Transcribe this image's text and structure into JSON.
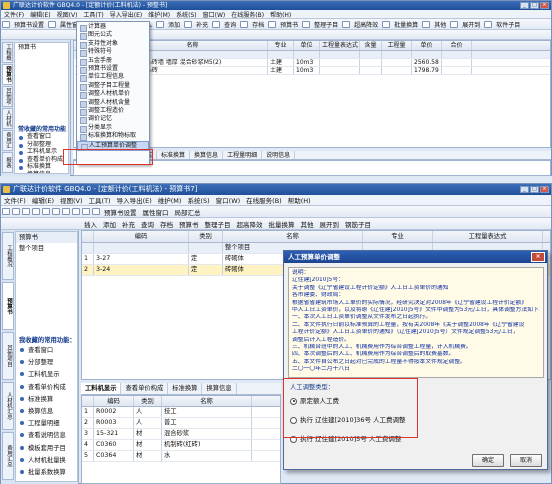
{
  "top": {
    "title": "广联达计价软件 GBQ4.0 - [定额计价(工料机法) - 预整书]",
    "menu": [
      "文件(F)",
      "编辑(E)",
      "视图(V)",
      "工具(T)",
      "导入导出(E)",
      "维护(M)",
      "系统(S)",
      "窗口(W)",
      "在线服务(B)",
      "帮助(H)"
    ],
    "toolbar": [
      "预算书设置",
      "属性窗口",
      "局部汇总",
      "插入",
      "添加",
      "补充",
      "查询",
      "存档",
      "预算书",
      "整理子目",
      "超高降效",
      "批量换算",
      "其他",
      "展开到",
      "软件子目"
    ],
    "side_tabs": [
      "工程概况",
      "预算书",
      "其他项目",
      "人材机汇总",
      "费用汇总",
      "报表"
    ],
    "nav_header": "常收藏的常用功能",
    "nav_items": [
      "查看窗口",
      "分部整理",
      "工料机显示",
      "查看单价构成",
      "标准换算",
      "换算信息",
      "工程量明细",
      "查看说明信息",
      "模板套价子目",
      "人材机批量换",
      "批量系数换算"
    ],
    "grid_headers": [
      "编码",
      "类别",
      "名称",
      "专业",
      "单位",
      "工程量表达式",
      "含量",
      "工程量",
      "单价",
      "合价"
    ],
    "grid_rows": [
      {
        "code": "",
        "cat": "",
        "name": "整个项目",
        "spec": "",
        "unit": "",
        "expr": "",
        "qty": "",
        "amt": "",
        "price": "",
        "total": ""
      },
      {
        "code": "3-27",
        "cat": "定",
        "name": "砖砌体 实心砖墙 墙厚 混合砂浆M5(2)",
        "spec": "土建",
        "unit": "10m3",
        "expr": "",
        "qty": "",
        "amt": "",
        "price": "2560.58",
        "total": ""
      },
      {
        "code": "3-24",
        "cat": "定",
        "name": "砖砌体 空心砖",
        "spec": "土建",
        "unit": "10m3",
        "expr": "",
        "qty": "",
        "amt": "",
        "price": "1798.79",
        "total": ""
      }
    ],
    "context_menu": [
      "计算器",
      "图元公式",
      "支持性对象",
      "特殊符号",
      "五金手册",
      "预算书设置",
      "单位工程信息",
      "调整子目工程量",
      "调整人材机单价",
      "调整人材机含量",
      "调整工程造价",
      "调价记忆",
      "分类显示",
      "标准换算和物标取",
      "人工预算单价调整"
    ],
    "bottom_tabs": [
      "工料机显示",
      "查看单价构成",
      "标准换算",
      "换算信息",
      "工程量明细",
      "说明信息"
    ]
  },
  "main": {
    "title": "广联达计价软件 GBQ4.0 - [定额计价(工料机法) - 预算书7]",
    "menu": [
      "文件(F)",
      "编辑(E)",
      "视图(V)",
      "工具(T)",
      "导入导出(E)",
      "维护(M)",
      "系统(S)",
      "窗口(W)",
      "在线服务(B)",
      "帮助(H)"
    ],
    "toolbar": [
      "预算书设置",
      "属性窗口",
      "局部汇总"
    ],
    "toolbar2": [
      "插入",
      "添加",
      "补充",
      "查询",
      "存档",
      "预算书",
      "整理子目",
      "超高降效",
      "批量换算",
      "其他",
      "展开到",
      "钢筋子目"
    ],
    "side_tabs": [
      "工程概况",
      "预算书",
      "其他项目",
      "人材机汇总",
      "费用汇总"
    ],
    "nav_header": "我收藏的常用功能：",
    "nav_items": [
      "查看窗口",
      "分部整理",
      "工料机显示",
      "查看单价构成",
      "标准换算",
      "换算信息",
      "工程量明细",
      "查看说明信息",
      "模板套用子目",
      "人材机批量换",
      "批量系数换算"
    ],
    "grid_headers": [
      "",
      "编码",
      "类别",
      "名称",
      "专业",
      "工程量表达式"
    ],
    "grid_rows": [
      {
        "no": "",
        "code": "",
        "cat": "",
        "name": "整个项目"
      },
      {
        "no": "1",
        "code": "3-27",
        "cat": "定",
        "name": "砖砌体"
      },
      {
        "no": "2",
        "code": "3-24",
        "cat": "定",
        "name": "砖砌体"
      }
    ],
    "bottom_tabs": [
      "工料机显示",
      "查看单价构成",
      "标准换算",
      "换算信息"
    ],
    "detail_headers": [
      "编码",
      "类别",
      "名称"
    ],
    "detail_rows": [
      {
        "no": "1",
        "code": "R0002",
        "cat": "人",
        "name": "技工"
      },
      {
        "no": "2",
        "code": "R0003",
        "cat": "人",
        "name": "普工"
      },
      {
        "no": "3",
        "code": "15-321",
        "cat": "材",
        "name": "混合砂浆"
      },
      {
        "no": "4",
        "code": "C0360",
        "cat": "材",
        "name": "机制砖(红砖)"
      },
      {
        "no": "5",
        "code": "C0364",
        "cat": "材",
        "name": "水"
      }
    ]
  },
  "dialog": {
    "title": "人工预算单价调整",
    "note_label": "说明：",
    "note_lines": [
      "辽住建[2010]5号：",
      "关于调整《辽宁省建设工程计价定额》人工日工资单价的通知",
      "各市建委、财政局：",
      "根据省省建筑市场人工单价的实际情况，经研究决定对2008年《辽宁省建设工程计价定额》",
      "中人工日工资单价，以及将原《辽住建[2010]5号》文件中调整为53元/工日，具体调整方法如下：",
      "一、本次人工日工资单价调整从文件发布之日起执行。",
      "二、本文件执行日前以标准预算的工程量，按有关2008年《关于调整2008年《辽宁省建设",
      "工程计价定额》人工日工资单价的通知》（辽住建[2010]5号）文件规定调整53元/工日，",
      "调整后计入工程造价。",
      "三、机械台班中的人工、机械费用作为综合调整工程量，计入机械费。",
      "四、本次调整后的人工、机械费用作为综合调整后的取费基数。",
      "五、本文件自公布之日起对已完成的工程量不得按本文件规定调整。",
      "二〇一〇年二月十八日"
    ],
    "group_label": "人工调整类型：",
    "options": [
      "原定额人工费",
      "执行 辽住建[2010]36号 人工费调整",
      "执行 辽住建[2010]5号 人工费调整"
    ],
    "selected_index": 0,
    "ok": "确定",
    "cancel": "取消"
  }
}
